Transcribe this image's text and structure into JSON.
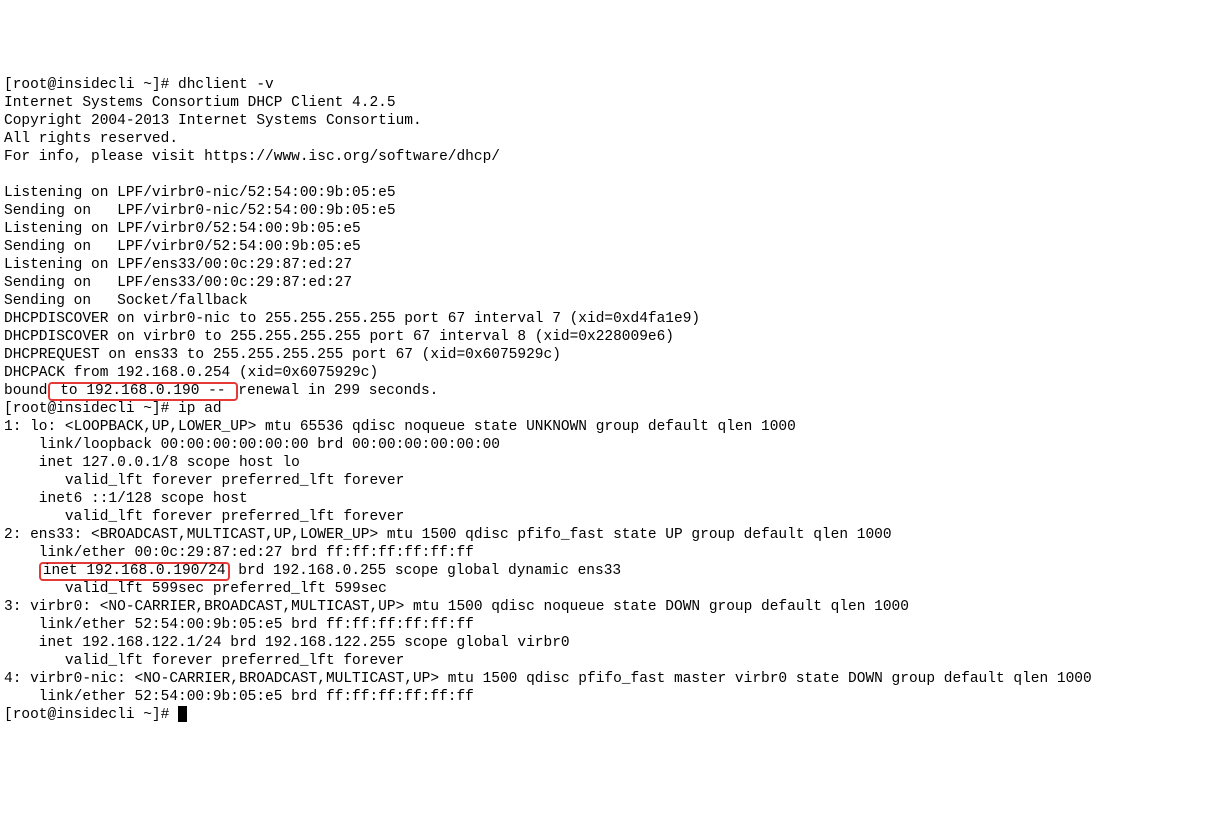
{
  "prompt1": "[root@insidecli ~]# ",
  "cmd1": "dhclient -v",
  "dhcp_out": [
    "Internet Systems Consortium DHCP Client 4.2.5",
    "Copyright 2004-2013 Internet Systems Consortium.",
    "All rights reserved.",
    "For info, please visit https://www.isc.org/software/dhcp/",
    "",
    "Listening on LPF/virbr0-nic/52:54:00:9b:05:e5",
    "Sending on   LPF/virbr0-nic/52:54:00:9b:05:e5",
    "Listening on LPF/virbr0/52:54:00:9b:05:e5",
    "Sending on   LPF/virbr0/52:54:00:9b:05:e5",
    "Listening on LPF/ens33/00:0c:29:87:ed:27",
    "Sending on   LPF/ens33/00:0c:29:87:ed:27",
    "Sending on   Socket/fallback",
    "DHCPDISCOVER on virbr0-nic to 255.255.255.255 port 67 interval 7 (xid=0xd4fa1e9)",
    "DHCPDISCOVER on virbr0 to 255.255.255.255 port 67 interval 8 (xid=0x228009e6)",
    "DHCPREQUEST on ens33 to 255.255.255.255 port 67 (xid=0x6075929c)",
    "DHCPACK from 192.168.0.254 (xid=0x6075929c)"
  ],
  "bound_prefix": "bound",
  "bound_highlight": " to 192.168.0.190 -- ",
  "bound_suffix": "renewal in 299 seconds.",
  "prompt2": "[root@insidecli ~]# ",
  "cmd2": "ip ad",
  "ipad_pre": [
    "1: lo: <LOOPBACK,UP,LOWER_UP> mtu 65536 qdisc noqueue state UNKNOWN group default qlen 1000",
    "    link/loopback 00:00:00:00:00:00 brd 00:00:00:00:00:00",
    "    inet 127.0.0.1/8 scope host lo",
    "       valid_lft forever preferred_lft forever",
    "    inet6 ::1/128 scope host ",
    "       valid_lft forever preferred_lft forever",
    "2: ens33: <BROADCAST,MULTICAST,UP,LOWER_UP> mtu 1500 qdisc pfifo_fast state UP group default qlen 1000",
    "    link/ether 00:0c:29:87:ed:27 brd ff:ff:ff:ff:ff:ff"
  ],
  "inet_pad": "    ",
  "inet_highlight": "inet 192.168.0.190/24",
  "inet_suffix": " brd 192.168.0.255 scope global dynamic ens33",
  "ipad_post": [
    "       valid_lft 599sec preferred_lft 599sec",
    "3: virbr0: <NO-CARRIER,BROADCAST,MULTICAST,UP> mtu 1500 qdisc noqueue state DOWN group default qlen 1000",
    "    link/ether 52:54:00:9b:05:e5 brd ff:ff:ff:ff:ff:ff",
    "    inet 192.168.122.1/24 brd 192.168.122.255 scope global virbr0",
    "       valid_lft forever preferred_lft forever",
    "4: virbr0-nic: <NO-CARRIER,BROADCAST,MULTICAST,UP> mtu 1500 qdisc pfifo_fast master virbr0 state DOWN group default qlen 1000",
    "    link/ether 52:54:00:9b:05:e5 brd ff:ff:ff:ff:ff:ff"
  ],
  "prompt3": "[root@insidecli ~]# "
}
